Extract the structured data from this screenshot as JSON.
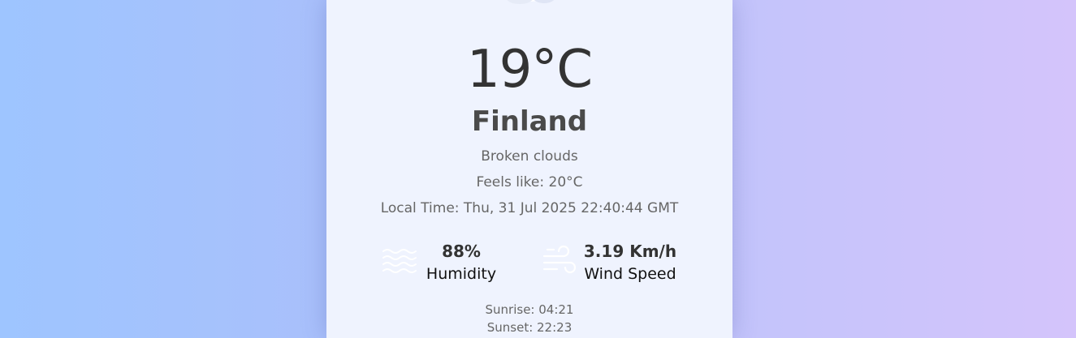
{
  "weather": {
    "icon": "cloud-icon",
    "temperature": "19°C",
    "city": "Finland",
    "description": "Broken clouds",
    "feels_like": "Feels like: 20°C",
    "local_time": "Local Time: Thu, 31 Jul 2025 22:40:44 GMT"
  },
  "stats": {
    "humidity": {
      "icon": "humidity-waves-icon",
      "value": "88%",
      "label": "Humidity"
    },
    "wind": {
      "icon": "wind-icon",
      "value": "3.19 Km/h",
      "label": "Wind Speed"
    }
  },
  "sun": {
    "sunrise": "Sunrise: 04:21",
    "sunset": "Sunset: 22:23"
  },
  "colors": {
    "card_background": "#eff3fe",
    "gradient_left": "#9ec5ff",
    "gradient_right": "#d4c4fb"
  }
}
